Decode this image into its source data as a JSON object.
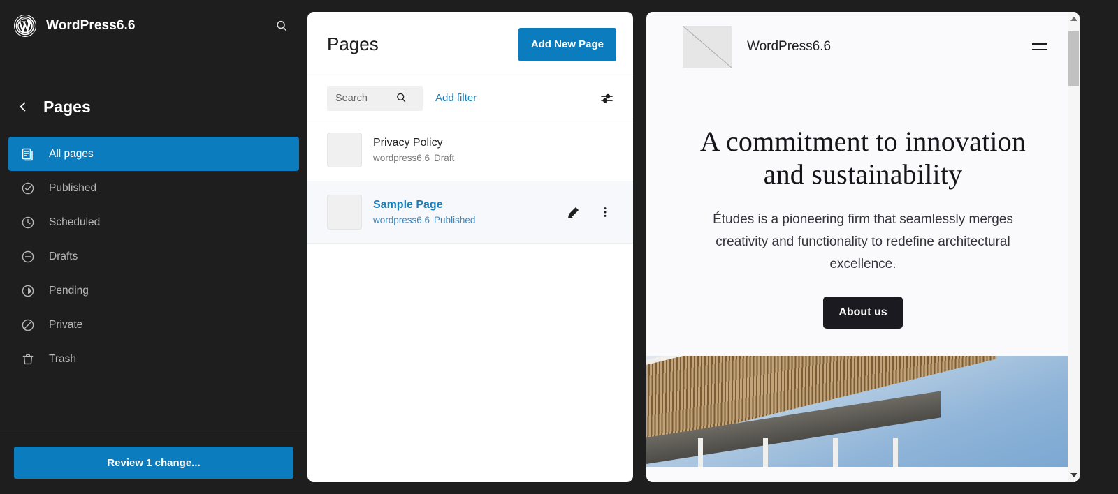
{
  "sidebar": {
    "site_title": "WordPress6.6",
    "search_icon": "search-icon",
    "logo_icon": "wordpress-logo-icon",
    "back_icon": "chevron-left-icon",
    "section_title": "Pages",
    "items": [
      {
        "label": "All pages",
        "icon": "pages-icon",
        "active": true
      },
      {
        "label": "Published",
        "icon": "check-circle-icon",
        "active": false
      },
      {
        "label": "Scheduled",
        "icon": "clock-icon",
        "active": false
      },
      {
        "label": "Drafts",
        "icon": "minus-circle-icon",
        "active": false
      },
      {
        "label": "Pending",
        "icon": "pending-icon",
        "active": false
      },
      {
        "label": "Private",
        "icon": "no-entry-icon",
        "active": false
      },
      {
        "label": "Trash",
        "icon": "trash-icon",
        "active": false
      }
    ],
    "review_button": "Review 1 change..."
  },
  "list_panel": {
    "title": "Pages",
    "add_new_button": "Add New Page",
    "search_placeholder": "Search",
    "search_value": "",
    "add_filter": "Add filter",
    "view_options_icon": "sliders-icon",
    "rows": [
      {
        "title": "Privacy Policy",
        "site": "wordpress6.6",
        "status": "Draft",
        "selected": false
      },
      {
        "title": "Sample Page",
        "site": "wordpress6.6",
        "status": "Published",
        "selected": true,
        "edit_icon": "pencil-icon",
        "more_icon": "kebab-menu-icon"
      }
    ]
  },
  "preview": {
    "site_title": "WordPress6.6",
    "logo_icon": "broken-image-placeholder-icon",
    "menu_icon": "hamburger-menu-icon",
    "hero_heading": "A commitment to innovation and sustainability",
    "paragraph": "Études is a pioneering firm that seamlessly merges creativity and functionality to redefine architectural excellence.",
    "cta_button": "About us",
    "hero_image_alt": "architectural wooden slatted canopy against blue sky",
    "scroll_up_icon": "scroll-up-arrow-icon",
    "scroll_down_icon": "scroll-down-arrow-icon"
  },
  "colors": {
    "accent_blue": "#0b7dbf",
    "link_blue": "#1a7fbd",
    "sidebar_bg": "#1e1e1e",
    "panel_bg": "#ffffff",
    "preview_bg": "#faf9fb",
    "cta_dark": "#1c1a21"
  }
}
